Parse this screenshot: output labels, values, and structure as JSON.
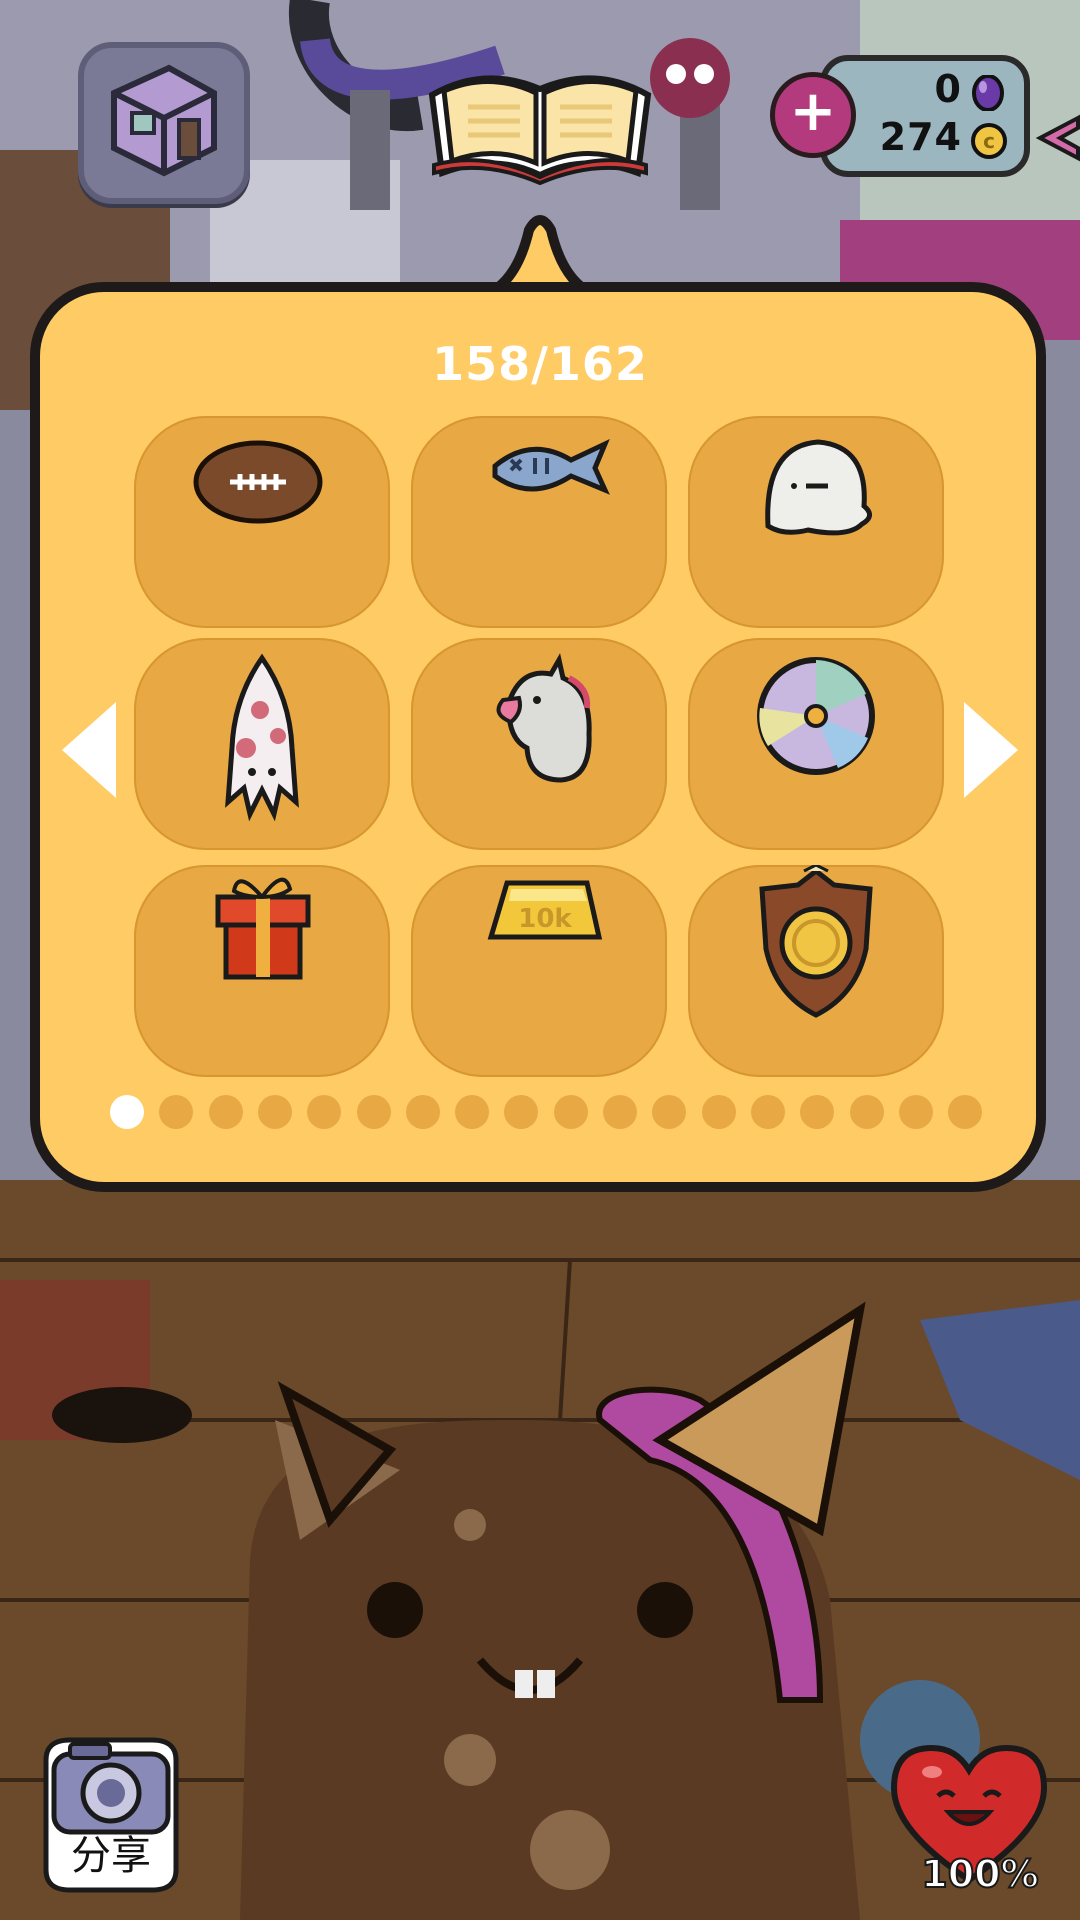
{
  "header": {
    "room_button_icon": "room-cube-icon",
    "collection_button_icon": "open-book-icon",
    "add_currency_icon": "plus-icon",
    "gems": "0",
    "coins": "274",
    "back_icon": "back-arrow-icon"
  },
  "collection": {
    "counter": "158/162",
    "page_dots_total": 18,
    "active_page_index": 0,
    "items": [
      {
        "icon": "football-icon"
      },
      {
        "icon": "fish-bone-icon"
      },
      {
        "icon": "ghost-icon"
      },
      {
        "icon": "squid-icon"
      },
      {
        "icon": "unicorn-plush-icon"
      },
      {
        "icon": "cd-disc-icon"
      },
      {
        "icon": "gift-box-icon"
      },
      {
        "icon": "gold-bar-10k-icon",
        "label": "10k"
      },
      {
        "icon": "coin-shield-trophy-icon"
      }
    ],
    "prev_icon": "chevron-left-icon",
    "next_icon": "chevron-right-icon"
  },
  "footer": {
    "share_label": "分享",
    "share_icon": "camera-icon",
    "health_icon": "heart-icon",
    "health_percent": "100%"
  },
  "colors": {
    "panel": "#fecb65",
    "tile": "#e8a843",
    "panel_border": "#1e1a19"
  }
}
